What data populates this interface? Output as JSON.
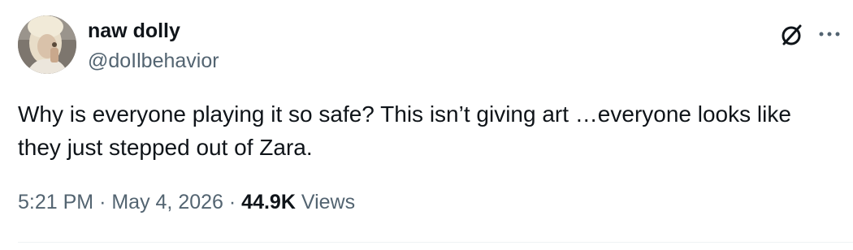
{
  "author": {
    "display_name": "naw dolly",
    "handle": "@doIlbehavior"
  },
  "tweet": {
    "text": "Why is everyone playing it so safe? This isn’t giving art …everyone looks like they just stepped out of Zara."
  },
  "meta": {
    "time": "5:21 PM",
    "separator": "·",
    "date": "May 4, 2026",
    "views_count": "44.9K",
    "views_label": "Views"
  },
  "icons": {
    "grok": "grok-slash-circle-icon",
    "more": "more-horizontal-icon"
  },
  "colors": {
    "text_primary": "#0f1419",
    "text_secondary": "#536471",
    "divider": "#eff3f4"
  }
}
